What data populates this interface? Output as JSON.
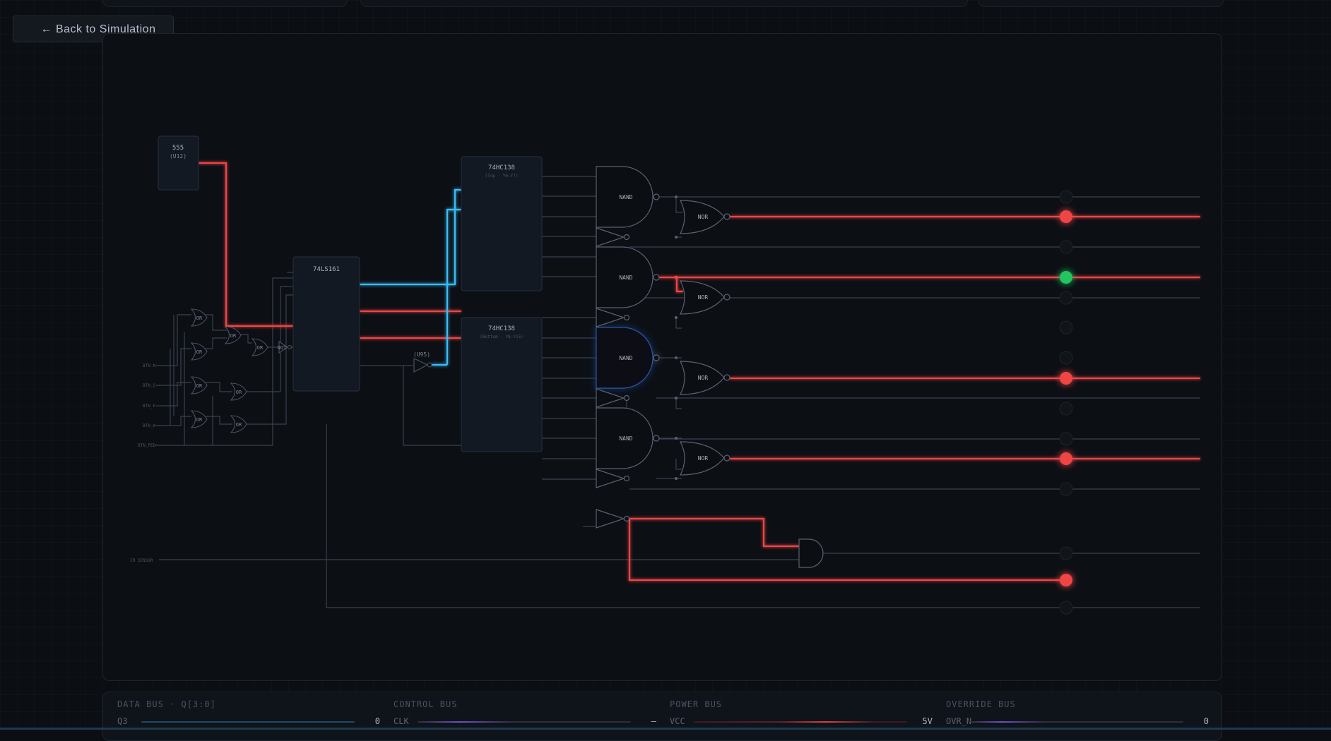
{
  "nav": {
    "back_label": "← Back to Simulation"
  },
  "chips": {
    "timer_name": "555",
    "timer_ref": "(U12)",
    "counter_name": "74LS161",
    "decoder_top_name": "74HC138",
    "decoder_top_sub": "(Top · Y0–Y7)",
    "decoder_bottom_name": "74HC138",
    "decoder_bottom_sub": "(Bottom · Y8–Y15)",
    "inverter_ref": "(U95)"
  },
  "gates": {
    "nand": "NAND",
    "nor": "NOR",
    "or": "OR",
    "not": "NOT"
  },
  "inputs": [
    "BTN_N",
    "BTN_S",
    "BTN_E",
    "BTN_W",
    "BTN_PED"
  ],
  "sensor_label": "IR SENSOR",
  "buses": [
    {
      "title": "DATA BUS · Q[3:0]",
      "signal": "Q3",
      "value": "0",
      "color": "#1f4a63"
    },
    {
      "title": "CONTROL BUS",
      "signal": "CLK",
      "value": "—",
      "color": "#6d4fc4"
    },
    {
      "title": "POWER BUS",
      "signal": "VCC",
      "value": "5V",
      "color": "#b9383a"
    },
    {
      "title": "OVERRIDE BUS",
      "signal": "OVR_N",
      "value": "0",
      "color": "#6d4fc4"
    }
  ],
  "colors": {
    "active": "#ef4444",
    "green": "#22c55e",
    "clock": "#38bdf8",
    "override": "#8b5cf6"
  }
}
